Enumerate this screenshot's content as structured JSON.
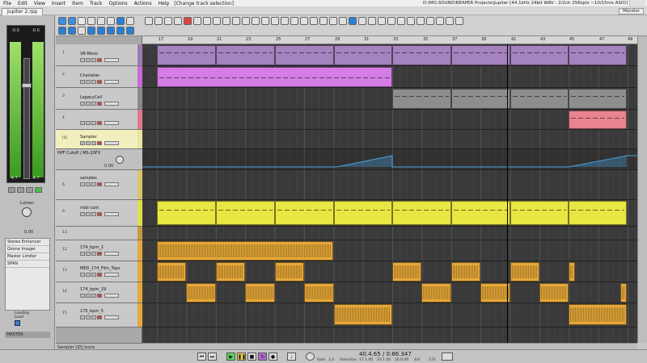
{
  "menu": {
    "items": [
      "File",
      "Edit",
      "View",
      "Insert",
      "Item",
      "Track",
      "Options",
      "Actions",
      "Help"
    ],
    "status": "[Change track selection]",
    "title": "D:\\MO.SOUND\\REAPER Projects\\Jupiter [44.1kHz 24bit WAV : 2/2ch 256spls ~10/15ms ASIO]"
  },
  "tabs": {
    "project": "Jupiter 2.rpp",
    "monitor": "Monitor"
  },
  "master": {
    "meter_left_top": "-0.0",
    "meter_right_top": "-0.0",
    "meter_left_bottom": "-4.7",
    "meter_right_bottom": "-4.7",
    "knob_label": "Lumen",
    "knob_value": "0.00",
    "fx": [
      "Stereo Enhancer",
      "Ozone Imager",
      "Master Limiter",
      "SPAN"
    ],
    "legend": [
      "Loading",
      "Load"
    ],
    "label": "MASTER"
  },
  "tracks": [
    {
      "num": "1",
      "name": "VR-Mono",
      "color": "#9b7ab5"
    },
    {
      "num": "2",
      "name": "Charlatan",
      "color": "#c86bd9"
    },
    {
      "num": "3",
      "name": "LegacyCell",
      "color": "#8a8a8a"
    },
    {
      "num": "4",
      "name": "",
      "color": "#e07a86"
    },
    {
      "num": "[5]",
      "name": "Sampler",
      "color": "#e9e4a0"
    },
    {
      "num": "6",
      "name": "samples",
      "color": "#d9c56b"
    },
    {
      "num": "9",
      "name": "midi cont",
      "color": "#dede46"
    },
    {
      "num": "11",
      "name": "",
      "color": "#c89b3e"
    },
    {
      "num": "12",
      "name": "174_bpm_2",
      "color": "#e6a83a"
    },
    {
      "num": "13",
      "name": "MED_174_Film_Tops",
      "color": "#e6a83a"
    },
    {
      "num": "14",
      "name": "174_bpm_29",
      "color": "#e6a83a"
    },
    {
      "num": "15",
      "name": "175_bpm_5",
      "color": "#e6a83a"
    }
  ],
  "envelope": {
    "label": "HPF Cutoff / MS-20FX",
    "value": "0.00"
  },
  "tcp_footer": "Sampler [ID] Icons",
  "ruler": [
    "17",
    "19",
    "21",
    "23",
    "25",
    "27",
    "29",
    "31",
    "33",
    "35",
    "37",
    "39",
    "41",
    "43",
    "45",
    "47",
    "49"
  ],
  "transport": {
    "position": "40.4.65 / 0:86.347",
    "sub": [
      "Rate",
      "1.0",
      "Selection",
      "17.1.00",
      "33.1.00",
      "16.0.00",
      "4/4",
      "174"
    ]
  },
  "colors": {
    "synth_purple": "#9b7ab5",
    "charlatan_pink": "#c86bd9",
    "gray": "#8a8a8a",
    "pink": "#e07a86",
    "yellow": "#e8e643",
    "orange": "#e6a83a",
    "envelope_blue": "#4aa3df"
  }
}
